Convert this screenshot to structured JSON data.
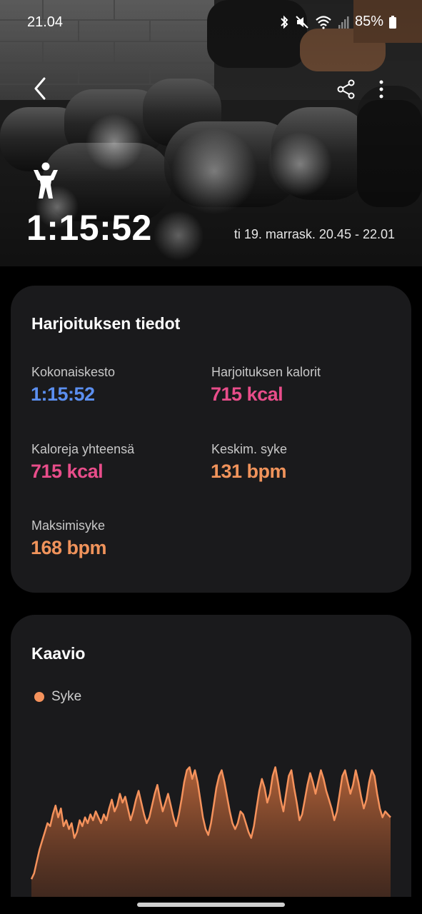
{
  "status_bar": {
    "time": "21.04",
    "battery": "85%"
  },
  "hero": {
    "duration": "1:15:52",
    "date_range": "ti 19. marrask. 20.45 - 22.01",
    "workout_icon": "person-workout-icon"
  },
  "details": {
    "title": "Harjoituksen tiedot",
    "stats": [
      {
        "label": "Kokonaiskesto",
        "value": "1:15:52",
        "color": "#5b8ff0"
      },
      {
        "label": "Harjoituksen kalorit",
        "value": "715 kcal",
        "color": "#e84d8a"
      },
      {
        "label": "Kaloreja yhteensä",
        "value": "715 kcal",
        "color": "#e84d8a"
      },
      {
        "label": "Keskim. syke",
        "value": "131 bpm",
        "color": "#f0935b"
      },
      {
        "label": "Maksimisyke",
        "value": "168 bpm",
        "color": "#f0935b"
      }
    ]
  },
  "chart": {
    "title": "Kaavio",
    "legend": "Syke",
    "color": "#f5925c"
  },
  "chart_data": {
    "type": "area",
    "series": [
      {
        "name": "Syke",
        "values": [
          92,
          96,
          104,
          112,
          118,
          124,
          130,
          128,
          136,
          142,
          134,
          140,
          128,
          132,
          126,
          130,
          120,
          124,
          132,
          128,
          134,
          130,
          136,
          132,
          138,
          134,
          130,
          136,
          132,
          140,
          146,
          138,
          142,
          150,
          144,
          148,
          140,
          132,
          138,
          146,
          152,
          144,
          136,
          130,
          134,
          142,
          150,
          156,
          146,
          138,
          144,
          150,
          142,
          134,
          128,
          136,
          146,
          158,
          166,
          168,
          160,
          166,
          158,
          146,
          134,
          126,
          122,
          130,
          142,
          154,
          162,
          166,
          158,
          148,
          138,
          130,
          126,
          130,
          138,
          136,
          130,
          124,
          120,
          128,
          140,
          152,
          160,
          154,
          144,
          150,
          162,
          168,
          158,
          146,
          138,
          150,
          162,
          166,
          154,
          144,
          132,
          136,
          146,
          156,
          164,
          158,
          150,
          158,
          166,
          160,
          152,
          146,
          140,
          132,
          138,
          150,
          162,
          166,
          158,
          150,
          156,
          166,
          158,
          148,
          140,
          146,
          158,
          166,
          162,
          150,
          140,
          134,
          138,
          136,
          134
        ]
      }
    ],
    "ylim": [
      80,
      175
    ]
  }
}
